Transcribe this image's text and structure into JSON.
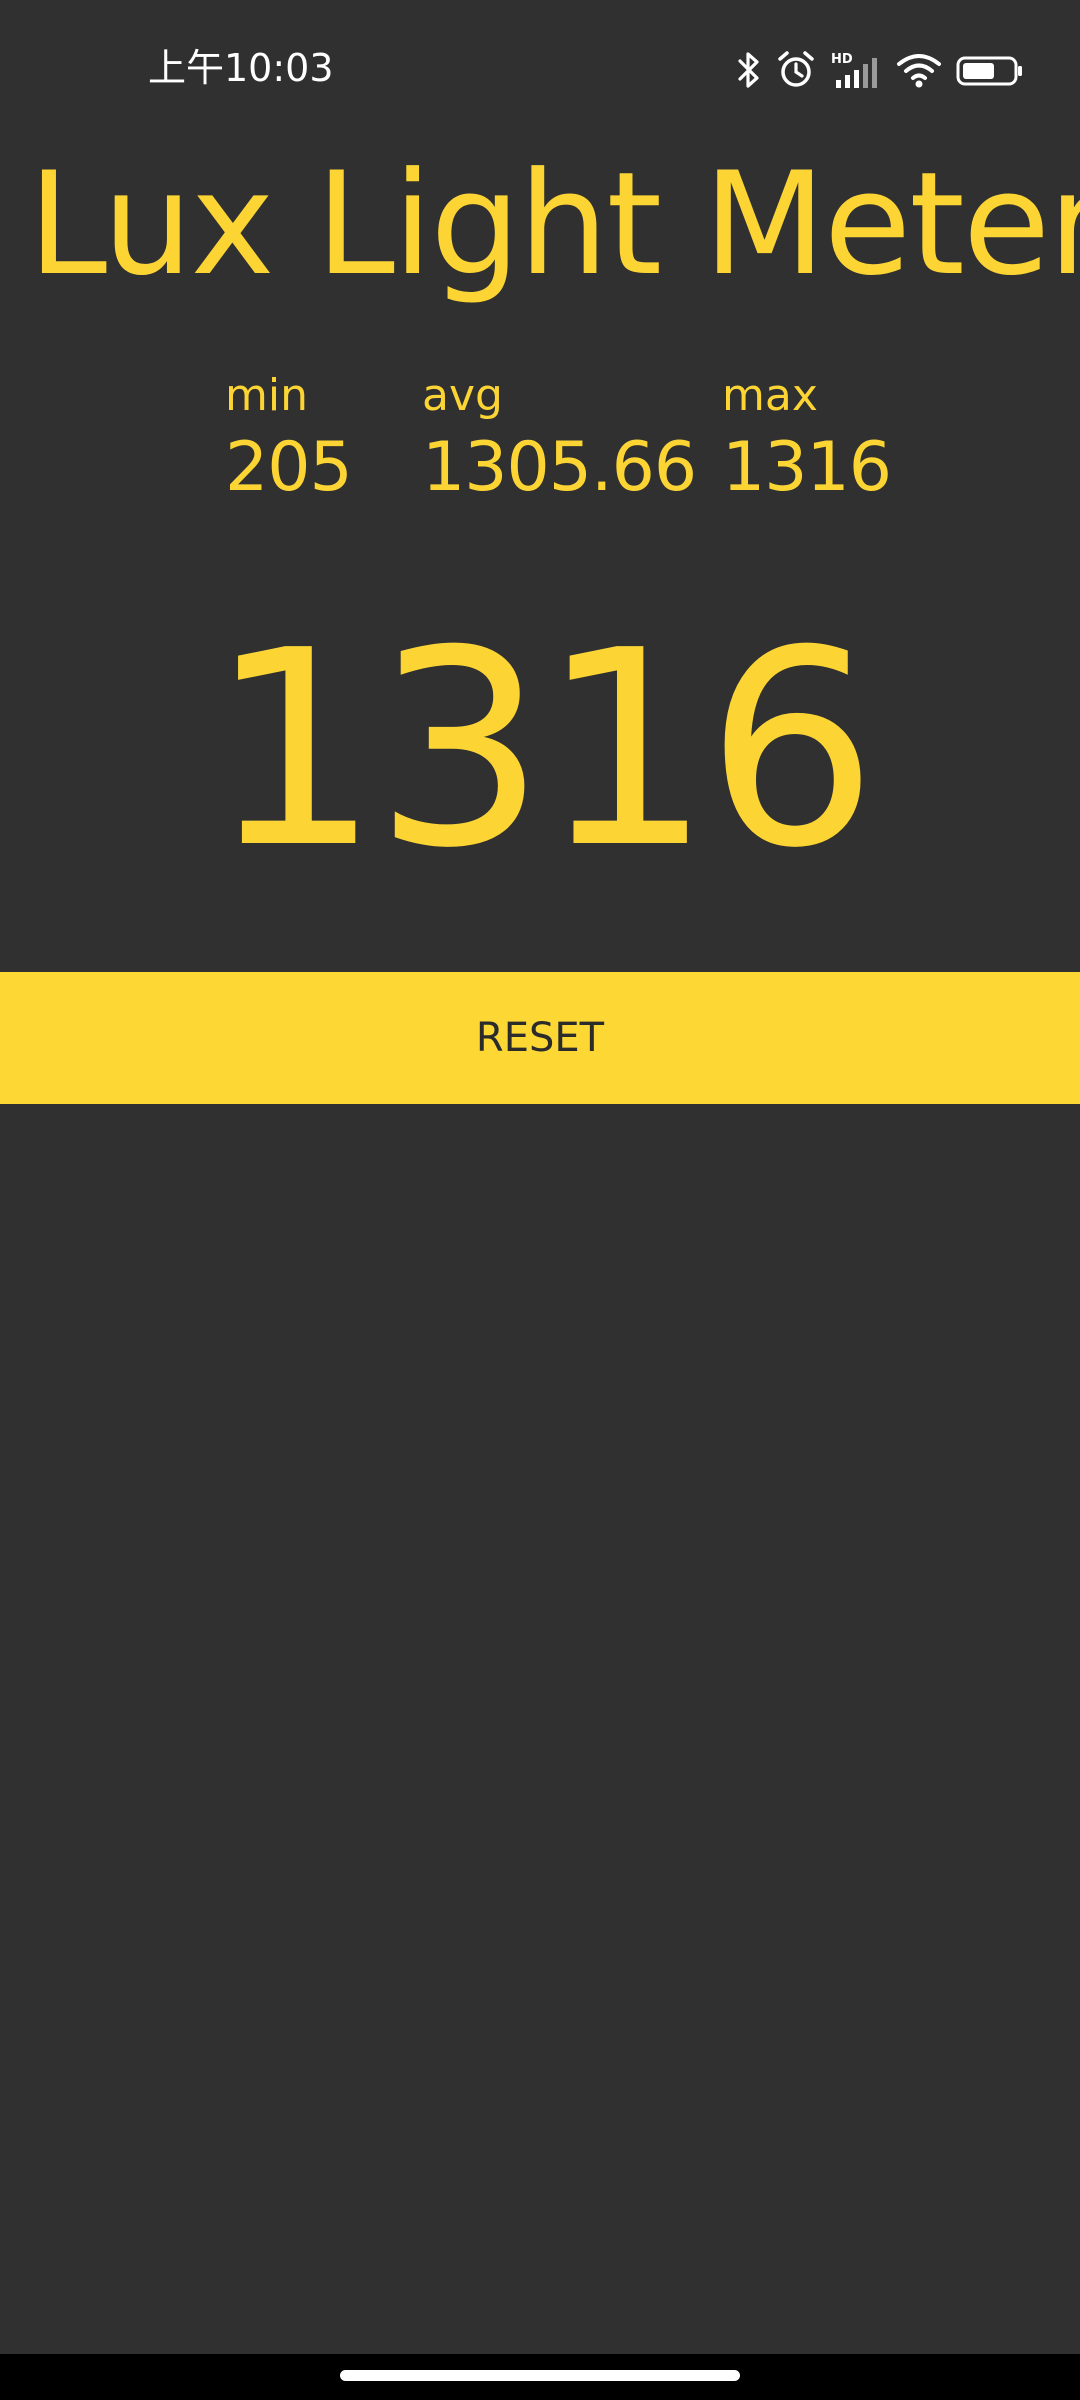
{
  "status_bar": {
    "time": "上午10:03",
    "icons": [
      "bluetooth-icon",
      "alarm-icon",
      "hd-signal-icon",
      "wifi-icon",
      "battery-icon"
    ],
    "signal_badge": "HD"
  },
  "app": {
    "title": "Lux Light Meter",
    "accent_color": "#fcd535",
    "background_color": "#303030"
  },
  "stats": {
    "min": {
      "label": "min",
      "value": "205"
    },
    "avg": {
      "label": "avg",
      "value": "1305.66"
    },
    "max": {
      "label": "max",
      "value": "1316"
    }
  },
  "current": {
    "value": "1316"
  },
  "actions": {
    "reset_label": "RESET"
  }
}
